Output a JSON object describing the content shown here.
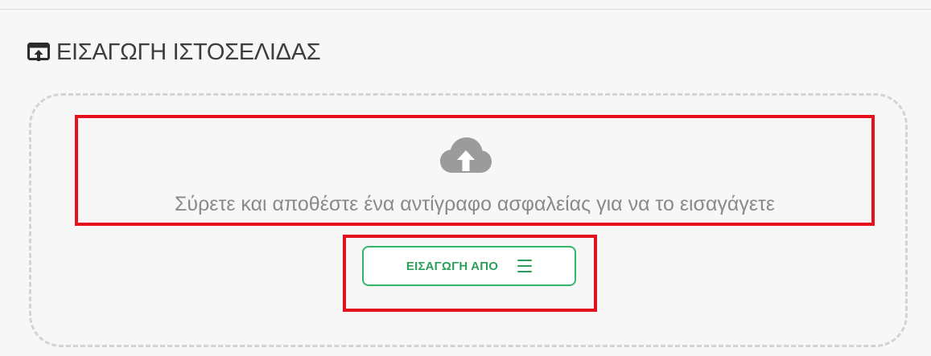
{
  "header": {
    "title": "ΕΙΣΑΓΩΓΗ ΙΣΤΟΣΕΛΙΔΑΣ",
    "icon": "import-website-icon"
  },
  "upload": {
    "icon": "cloud-upload-icon",
    "text": "Σύρετε και αποθέστε ένα αντίγραφο ασφαλείας για να το εισαγάγετε"
  },
  "import_button": {
    "label": "ΕΙΣΑΓΩΓΗ ΑΠΟ",
    "icon": "menu-icon"
  },
  "colors": {
    "accent_green": "#38b46a",
    "highlight_red": "#e5121e",
    "muted_text": "#8a8a8a",
    "icon_gray": "#9b9b9b"
  }
}
